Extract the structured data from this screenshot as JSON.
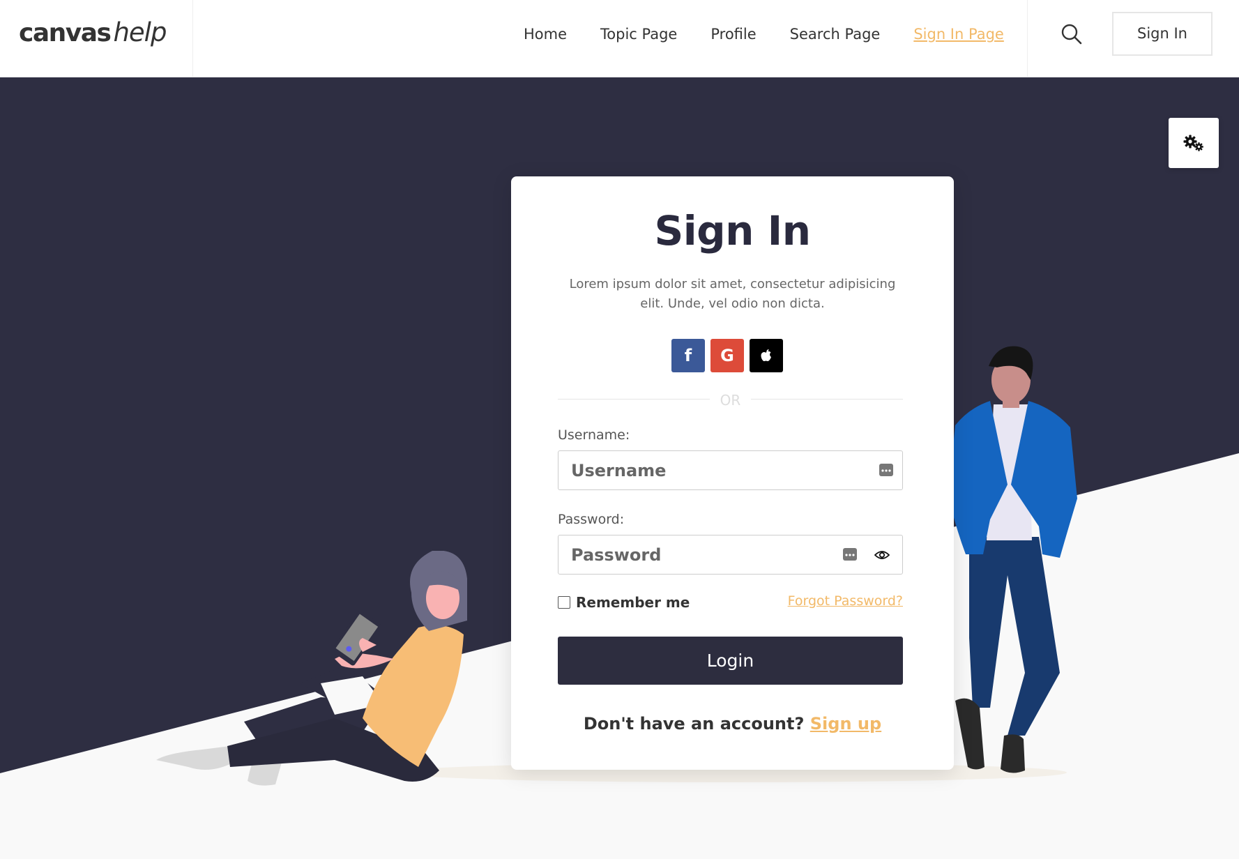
{
  "logo": {
    "bold": "canvas",
    "italic": "help"
  },
  "nav": {
    "items": [
      "Home",
      "Topic Page",
      "Profile",
      "Search Page",
      "Sign In Page"
    ],
    "active": "Sign In Page",
    "signin_button": "Sign In",
    "search_icon": "search-icon"
  },
  "settings": {
    "icon": "gears-icon"
  },
  "card": {
    "title": "Sign In",
    "description": "Lorem ipsum dolor sit amet, consectetur adipisicing elit. Unde, vel odio non dicta.",
    "social": [
      {
        "name": "facebook",
        "glyph": "f",
        "color": "#3b5998"
      },
      {
        "name": "google",
        "glyph": "G",
        "color": "#dd4b39"
      },
      {
        "name": "apple",
        "glyph": "",
        "color": "#000000"
      }
    ],
    "divider": "OR",
    "username_label": "Username:",
    "username_placeholder": "Username",
    "password_label": "Password:",
    "password_placeholder": "Password",
    "remember": "Remember me",
    "forgot": "Forgot Password?",
    "login": "Login",
    "signup_prompt": "Don't have an account?",
    "signup_link": "Sign up"
  },
  "colors": {
    "dark": "#2e2e42",
    "accent": "#f2b968",
    "light_bg": "#f9f9f9"
  }
}
